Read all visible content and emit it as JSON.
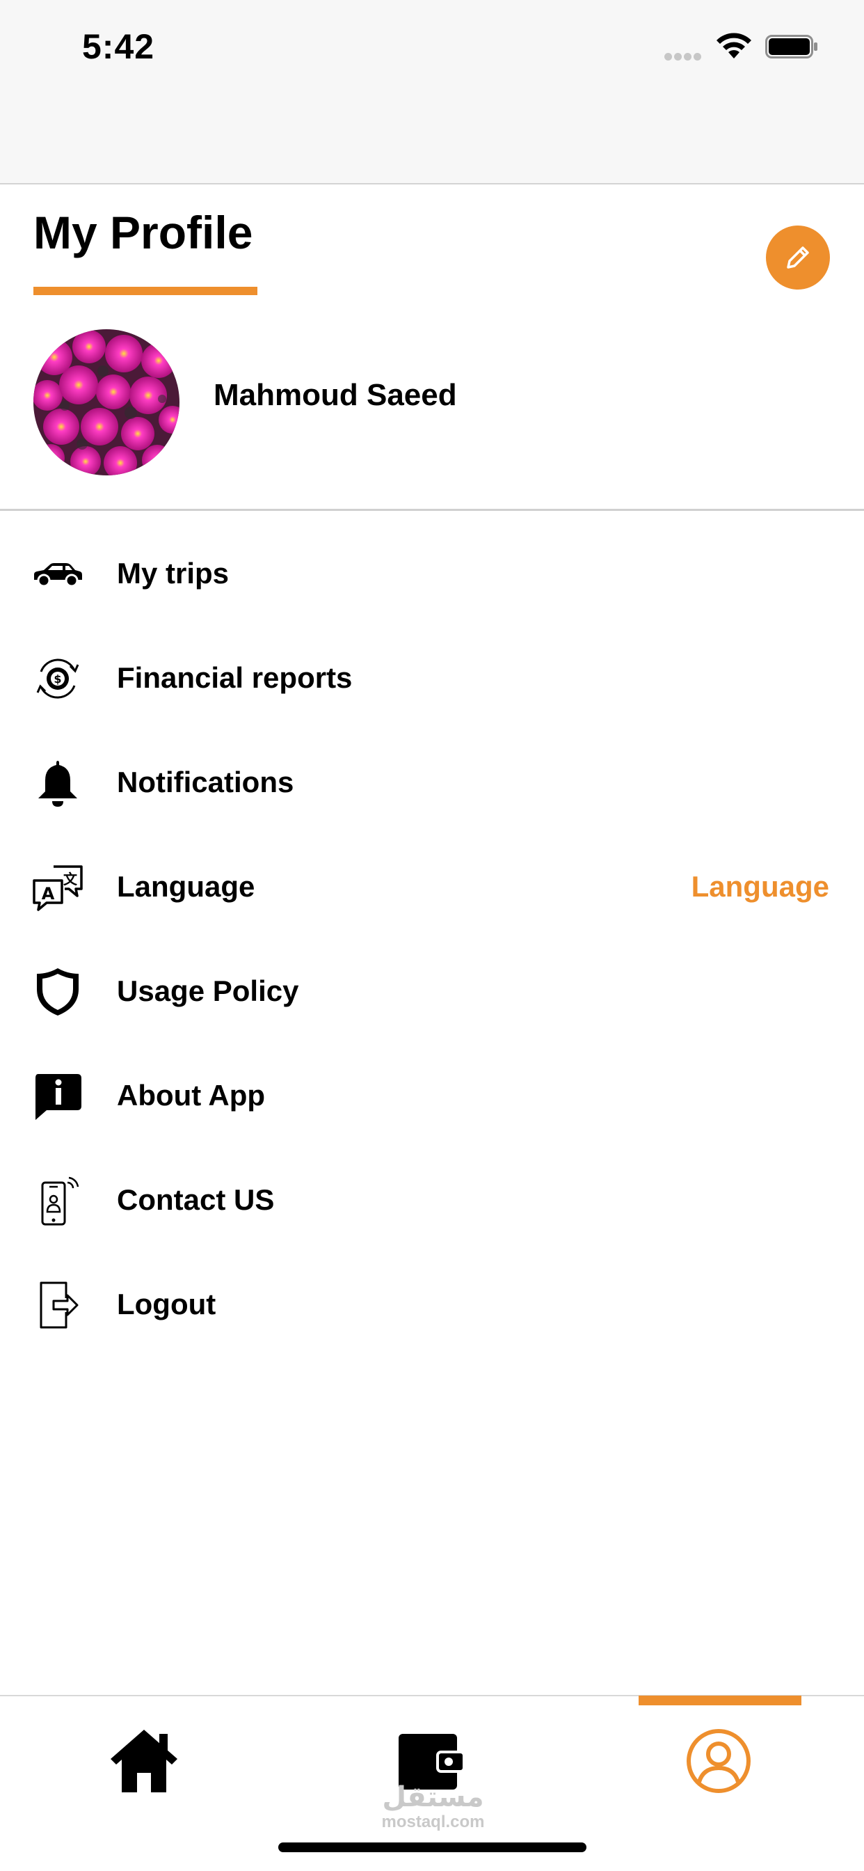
{
  "status_bar": {
    "time": "5:42",
    "icons": [
      "signal-dots-icon",
      "wifi-icon",
      "battery-icon"
    ]
  },
  "header": {
    "title": "My Profile",
    "edit_icon": "pencil-icon"
  },
  "profile": {
    "name": "Mahmoud Saeed",
    "avatar": "flower-photo-avatar"
  },
  "menu": {
    "items": [
      {
        "label": "My trips",
        "icon": "car-icon"
      },
      {
        "label": "Financial reports",
        "icon": "dollar-cycle-icon"
      },
      {
        "label": "Notifications",
        "icon": "bell-icon"
      },
      {
        "label": "Language",
        "icon": "translate-icon",
        "value": "Language"
      },
      {
        "label": "Usage Policy",
        "icon": "shield-icon"
      },
      {
        "label": "About App",
        "icon": "info-chat-icon"
      },
      {
        "label": "Contact US",
        "icon": "phone-contact-icon"
      },
      {
        "label": "Logout",
        "icon": "logout-icon"
      }
    ]
  },
  "bottom_nav": {
    "items": [
      {
        "icon": "home-icon",
        "active": false
      },
      {
        "icon": "wallet-icon",
        "active": false
      },
      {
        "icon": "user-circle-icon",
        "active": true
      }
    ],
    "watermark": {
      "arabic": "مستقل",
      "latin": "mostaql.com"
    }
  },
  "colors": {
    "accent": "#ee8f2d",
    "text": "#000000",
    "status_bar_bg": "#f7f7f7",
    "divider": "#d0d0d0"
  }
}
